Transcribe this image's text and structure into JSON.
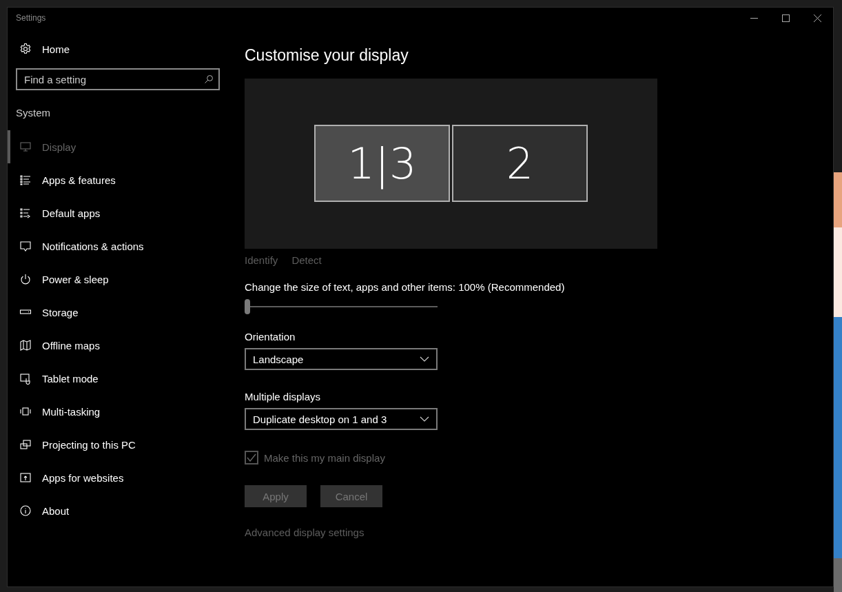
{
  "window": {
    "title": "Settings"
  },
  "sidebar": {
    "home": "Home",
    "search": {
      "placeholder": "Find a setting"
    },
    "section": "System",
    "items": [
      {
        "label": "Display",
        "selected": true
      },
      {
        "label": "Apps & features",
        "selected": false
      },
      {
        "label": "Default apps",
        "selected": false
      },
      {
        "label": "Notifications & actions",
        "selected": false
      },
      {
        "label": "Power & sleep",
        "selected": false
      },
      {
        "label": "Storage",
        "selected": false
      },
      {
        "label": "Offline maps",
        "selected": false
      },
      {
        "label": "Tablet mode",
        "selected": false
      },
      {
        "label": "Multi-tasking",
        "selected": false
      },
      {
        "label": "Projecting to this PC",
        "selected": false
      },
      {
        "label": "Apps for websites",
        "selected": false
      },
      {
        "label": "About",
        "selected": false
      }
    ]
  },
  "content": {
    "title": "Customise your display",
    "displays": [
      {
        "label": "1|3",
        "selected": true
      },
      {
        "label": "2",
        "selected": false
      }
    ],
    "links": [
      "Identify",
      "Detect"
    ],
    "scale": {
      "label": "Change the size of text, apps and other items: 100% (Recommended)",
      "level": 0
    },
    "orientation": {
      "label": "Orientation",
      "value": "Landscape"
    },
    "multiple_displays": {
      "label": "Multiple displays",
      "value": "Duplicate desktop on 1 and 3"
    },
    "main_display": {
      "label": "Make this my main display",
      "checked": true,
      "disabled": true
    },
    "buttons": [
      {
        "label": "Apply",
        "disabled": true
      },
      {
        "label": "Cancel",
        "disabled": true
      }
    ],
    "advanced_link": "Advanced display settings"
  }
}
